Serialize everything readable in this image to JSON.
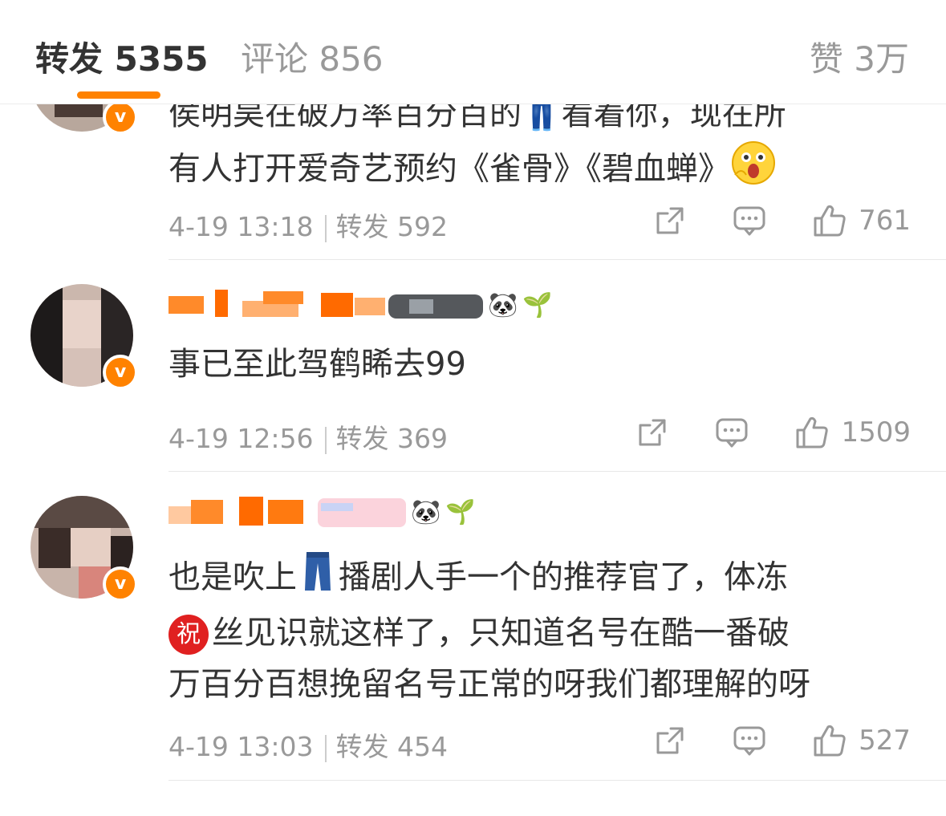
{
  "tabs": {
    "reposts": "转发 5355",
    "comments": "评论 856",
    "likes": "赞 3万"
  },
  "comments": [
    {
      "verified_mark": "v",
      "text_line1": "侯明昊在破万率百分百的👖看着你，现在所",
      "text_line2": "有人打开爱奇艺预约《雀骨》《碧血蝉》",
      "time": "4-19 13:18",
      "repost_label": "转发 592",
      "like_count": "761"
    },
    {
      "verified_mark": "v",
      "text": "事已至此驾鹤睎去99",
      "time": "4-19 12:56",
      "repost_label": "转发 369",
      "like_count": "1509"
    },
    {
      "verified_mark": "v",
      "text_line1_a": "也是吹上",
      "text_line1_b": "播剧人手一个的推荐官了，体冻",
      "text_line2_badge": "祝",
      "text_line2": "丝见识就这样了，只知道名号在酷一番破",
      "text_line3": "万百分百想挽留名号正常的呀我们都理解的呀",
      "time": "4-19 13:03",
      "repost_label": "转发 454",
      "like_count": "527"
    }
  ],
  "icons": {
    "share": "share-icon",
    "comment": "comment-icon",
    "like": "thumbs-up-icon",
    "panda": "🐼",
    "sprout": "🌱"
  },
  "colors": {
    "accent": "#ff8200",
    "muted": "#999999",
    "text": "#333333"
  }
}
